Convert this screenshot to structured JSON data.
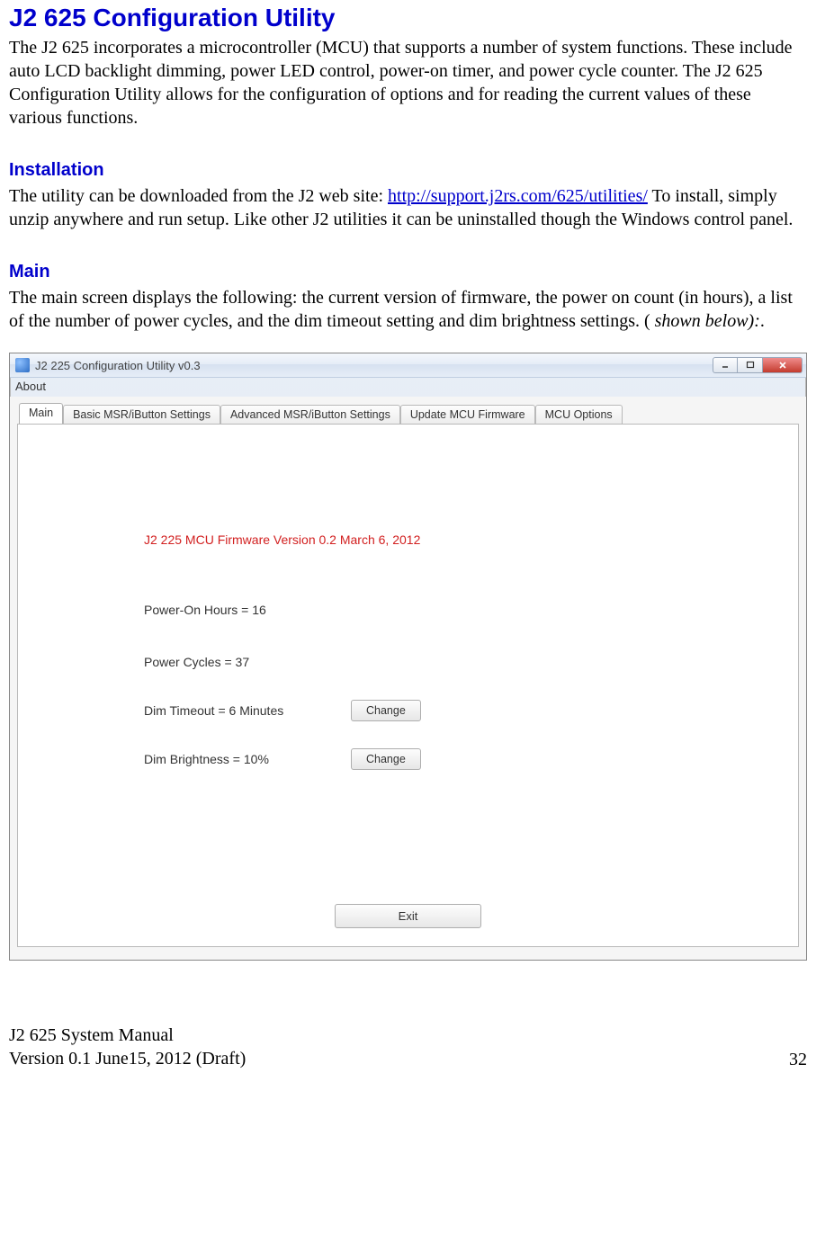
{
  "title": "J2 625 Configuration Utility",
  "intro": "The J2 625 incorporates a microcontroller (MCU) that supports a number of system functions. These include auto LCD backlight dimming, power LED control, power-on timer, and power cycle counter. The J2 625 Configuration Utility allows for the configuration of options and for reading the current values of these various functions.",
  "sections": {
    "installation": {
      "heading": "Installation",
      "text_before_link": "The utility can be downloaded from the J2 web site: ",
      "link": "http://support.j2rs.com/625/utilities/",
      "text_after_link": " To install, simply unzip anywhere and run setup. Like other J2 utilities it can be uninstalled though the Windows control panel."
    },
    "main": {
      "heading": "Main",
      "text_before_italic": "The main screen displays the following:  the current version of firmware, the power on count (in hours), a list of the number of power cycles, and the dim timeout setting and dim brightness settings.  ( ",
      "italic": "shown below):",
      "text_after_italic": "."
    }
  },
  "window": {
    "title": "J2 225 Configuration Utility  v0.3",
    "menu": {
      "about": "About"
    },
    "tabs": [
      "Main",
      "Basic MSR/iButton Settings",
      "Advanced MSR/iButton Settings",
      "Update MCU Firmware",
      "MCU Options"
    ],
    "firmware_line": "J2 225 MCU Firmware Version 0.2 March 6, 2012",
    "power_on_hours": "Power-On Hours = 16",
    "power_cycles": "Power Cycles = 37",
    "dim_timeout": "Dim Timeout = 6 Minutes",
    "dim_brightness": "Dim Brightness = 10%",
    "change_label": "Change",
    "exit_label": "Exit"
  },
  "footer": {
    "manual": "J2 625 System Manual",
    "version": "Version 0.1 June15, 2012 (Draft)",
    "page": "32"
  }
}
